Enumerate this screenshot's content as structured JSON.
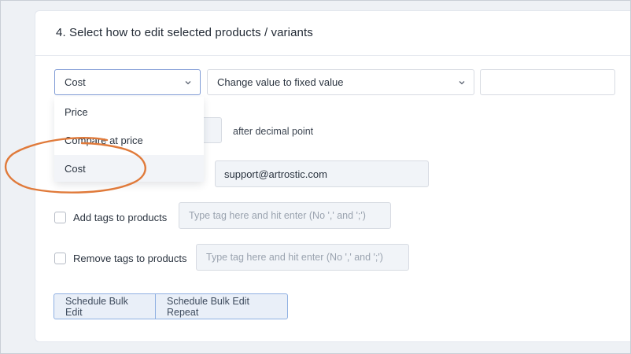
{
  "section": {
    "title": "4. Select how to edit selected products / variants"
  },
  "field_select": {
    "value": "Cost",
    "options": [
      "Price",
      "Compare at price",
      "Cost"
    ],
    "highlighted": "Cost"
  },
  "action_select": {
    "value": "Change value to fixed value"
  },
  "value_input": {
    "value": ""
  },
  "decimal": {
    "suffix_label": "after decimal point"
  },
  "email": {
    "value": "support@artrostic.com"
  },
  "add_tags": {
    "label": "Add tags to products",
    "placeholder": "Type tag here and hit enter (No ',' and ';')",
    "checked": false
  },
  "remove_tags": {
    "label": "Remove tags to products",
    "placeholder": "Type tag here and hit enter (No ',' and ';')",
    "checked": false
  },
  "buttons": {
    "schedule": "Schedule Bulk Edit",
    "schedule_repeat": "Schedule Bulk Edit Repeat"
  },
  "colors": {
    "annotation": "#e07a3a",
    "button_border": "#8fb0e2",
    "focus_border": "#7f9bd6"
  }
}
